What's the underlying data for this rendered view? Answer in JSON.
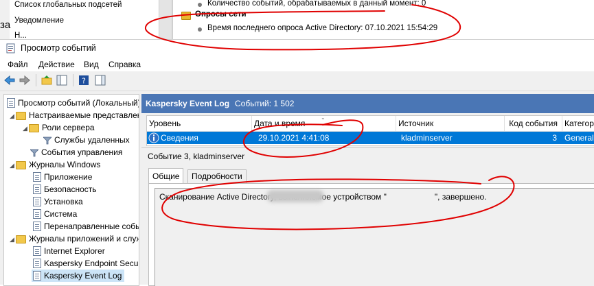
{
  "background_window": {
    "left_items": [
      "Список глобальных подсетей",
      "Уведомление"
    ],
    "left_item_partial": "Н...",
    "side_text": "за",
    "partial_top_line": "Количество событий, обрабатываемых в данный момент: 0",
    "section_title": "Опросы сети",
    "section_line": "Время последнего опроса Active Directory: 07.10.2021 15:54:29"
  },
  "window": {
    "title": "Просмотр событий",
    "menu": [
      "Файл",
      "Действие",
      "Вид",
      "Справка"
    ]
  },
  "tree": {
    "items": [
      {
        "label": "Просмотр событий (Локальный)",
        "icon": "event-viewer-icon"
      },
      {
        "label": "Настраиваемые представления",
        "icon": "folder-icon"
      },
      {
        "label": "Роли сервера",
        "icon": "folder-icon"
      },
      {
        "label": "Службы удаленных",
        "icon": "filter-icon"
      },
      {
        "label": "События управления",
        "icon": "filter-icon"
      },
      {
        "label": "Журналы Windows",
        "icon": "folder-icon"
      },
      {
        "label": "Приложение",
        "icon": "log-icon"
      },
      {
        "label": "Безопасность",
        "icon": "log-icon"
      },
      {
        "label": "Установка",
        "icon": "log-icon"
      },
      {
        "label": "Система",
        "icon": "log-icon"
      },
      {
        "label": "Перенаправленные события",
        "icon": "log-icon"
      },
      {
        "label": "Журналы приложений и служб",
        "icon": "folder-icon"
      },
      {
        "label": "Internet Explorer",
        "icon": "log-icon"
      },
      {
        "label": "Kaspersky Endpoint Security",
        "icon": "log-icon"
      },
      {
        "label": "Kaspersky Event Log",
        "icon": "log-icon"
      }
    ]
  },
  "list": {
    "log_name": "Kaspersky Event Log",
    "events_count": "Событий: 1 502",
    "columns": [
      "Уровень",
      "Дата и время",
      "Источник",
      "Код события",
      "Категория"
    ],
    "rows": [
      {
        "level": "Сведения",
        "datetime": "29.10.2021 4:41:08",
        "source": "kladminserver",
        "event_id": "3",
        "category": "General"
      }
    ]
  },
  "detail": {
    "title": "Событие 3, kladminserver",
    "tabs": [
      "Общие",
      "Подробности"
    ],
    "message_before": "Сканирование Active Directory, выполняемое устройством \"",
    "message_after": "\", завершено."
  },
  "colors": {
    "header_blue": "#4a76b5",
    "selection_blue": "#0078d7",
    "annotation_red": "#e00000"
  }
}
